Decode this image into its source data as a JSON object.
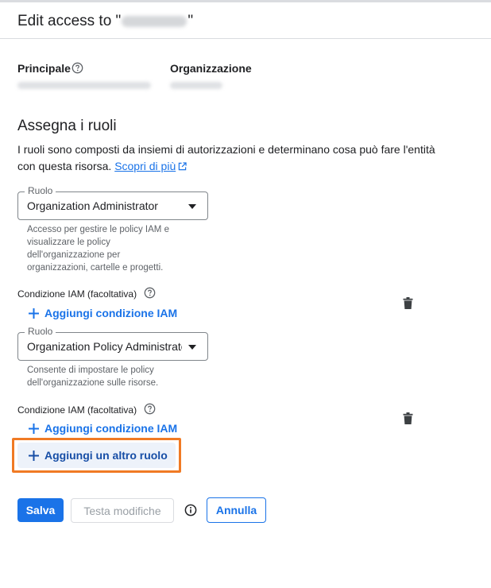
{
  "dialog": {
    "title_prefix": "Edit access to \"",
    "title_suffix": "\""
  },
  "principal": {
    "label": "Principale",
    "help_icon": "help-circle-icon"
  },
  "organization": {
    "label": "Organizzazione"
  },
  "assign_roles": {
    "title": "Assegna i ruoli",
    "description": "I ruoli sono composti da insiemi di autorizzazioni e determinano cosa può fare l'entità con questa risorsa.",
    "learn_more": "Scopri di più"
  },
  "roles": [
    {
      "field_label": "Ruolo",
      "value": "Organization Administrator",
      "helper_lines": [
        "Accesso per gestire le policy IAM e",
        "visualizzare le policy",
        "dell'organizzazione per",
        "organizzazioni, cartelle e progetti."
      ],
      "condition_label": "Condizione IAM (facoltativa)",
      "add_condition": "Aggiungi condizione IAM"
    },
    {
      "field_label": "Ruolo",
      "value": "Organization Policy Administrator",
      "helper_lines": [
        "Consente di impostare le policy",
        "dell'organizzazione sulle risorse."
      ],
      "condition_label": "Condizione IAM (facoltativa)",
      "add_condition": "Aggiungi condizione IAM"
    }
  ],
  "add_role_button": "Aggiungi un altro ruolo",
  "actions": {
    "save": "Salva",
    "test": "Testa modifiche",
    "cancel": "Annulla"
  },
  "colors": {
    "primary": "#1a73e8",
    "highlight": "#f07a24",
    "text": "#202124",
    "muted": "#5f6368"
  }
}
